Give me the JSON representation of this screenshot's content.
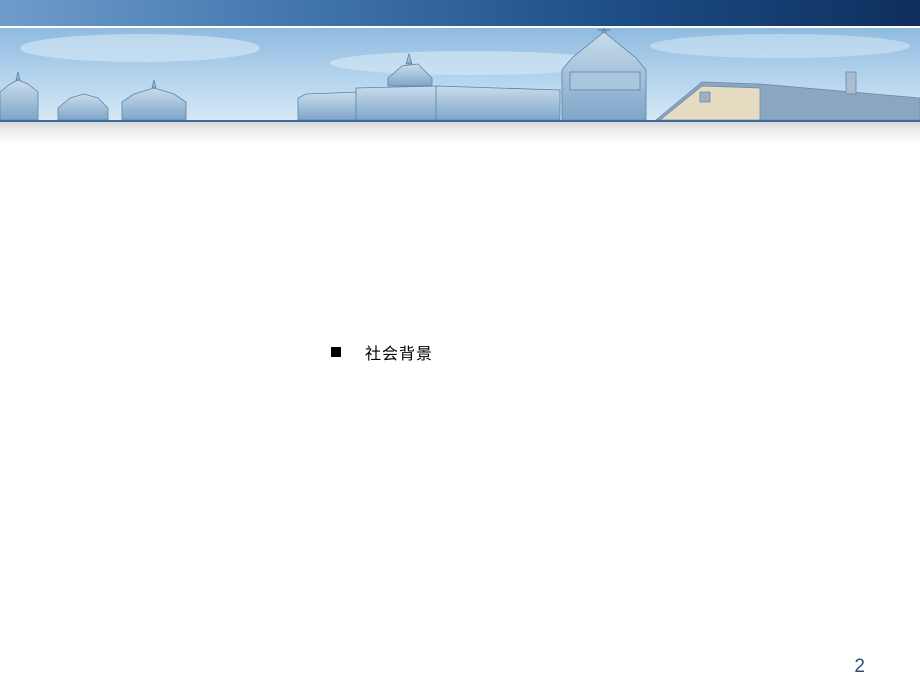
{
  "slide": {
    "bullets": [
      {
        "text": "社会背景"
      }
    ],
    "page_number": "2"
  },
  "colors": {
    "top_bar_dark": "#0e2f5e",
    "top_bar_light": "#6f9ccb",
    "banner_sky": "#a9cbe6",
    "page_number": "#2d4f7d"
  },
  "icons": {
    "bullet": "square-bullet-icon"
  }
}
